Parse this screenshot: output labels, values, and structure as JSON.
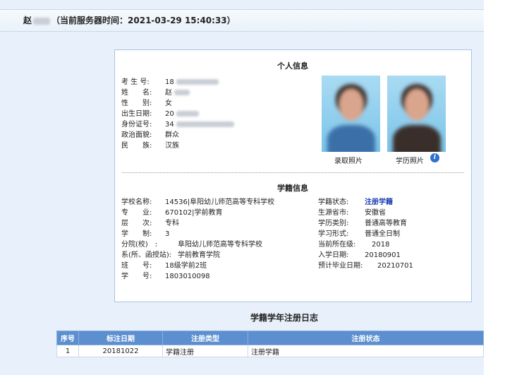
{
  "header": {
    "name_prefix": "赵",
    "server_time_label": "（当前服务器时间：2021-03-29 15:40:33）"
  },
  "personal": {
    "title": "个人信息",
    "fields": [
      {
        "label": "考 生 号:",
        "value": "18"
      },
      {
        "label": "姓　　名:",
        "value": "赵"
      },
      {
        "label": "性　　别:",
        "value": "女"
      },
      {
        "label": "出生日期:",
        "value": "20"
      },
      {
        "label": "身份证号:",
        "value": "34"
      },
      {
        "label": "政治面貌:",
        "value": "群众"
      },
      {
        "label": "民　　族:",
        "value": "汉族"
      }
    ],
    "photo_admission_caption": "录取照片",
    "photo_degree_caption": "学历照片"
  },
  "enrollment": {
    "title": "学籍信息",
    "left_fields": [
      {
        "label": "学校名称:",
        "value": "14536|阜阳幼儿师范高等专科学校"
      },
      {
        "label": "专　　业:",
        "value": "670102|学前教育"
      },
      {
        "label": "层　　次:",
        "value": "专科"
      },
      {
        "label": "学　　制:",
        "value": "3"
      },
      {
        "label": "分院(校)　:",
        "value": "阜阳幼儿师范高等专科学校"
      },
      {
        "label": "系(所、函授站):",
        "value": "学前教育学院"
      },
      {
        "label": "班　　号:",
        "value": "18级学前2班"
      },
      {
        "label": "学　　号:",
        "value": "1803010098"
      }
    ],
    "right_fields": [
      {
        "label": "学籍状态:",
        "value": "注册学籍"
      },
      {
        "label": "生源省市:",
        "value": "安徽省"
      },
      {
        "label": "学历类别:",
        "value": "普通高等教育"
      },
      {
        "label": "学习形式:",
        "value": "普通全日制"
      },
      {
        "label": "当前所在级:",
        "value": "2018"
      },
      {
        "label": "入学日期:",
        "value": "20180901"
      },
      {
        "label": "预计毕业日期:",
        "value": "20210701"
      }
    ]
  },
  "log": {
    "title": "学籍学年注册日志",
    "columns": [
      "序号",
      "标注日期",
      "注册类型",
      "注册状态"
    ],
    "rows": [
      {
        "index": "1",
        "date": "20181022",
        "type": "学籍注册",
        "status": "注册学籍"
      }
    ]
  },
  "colors": {
    "accent": "#5c8fd0",
    "status_text": "#1a3fb0",
    "info_icon": "#2f6fd1"
  }
}
